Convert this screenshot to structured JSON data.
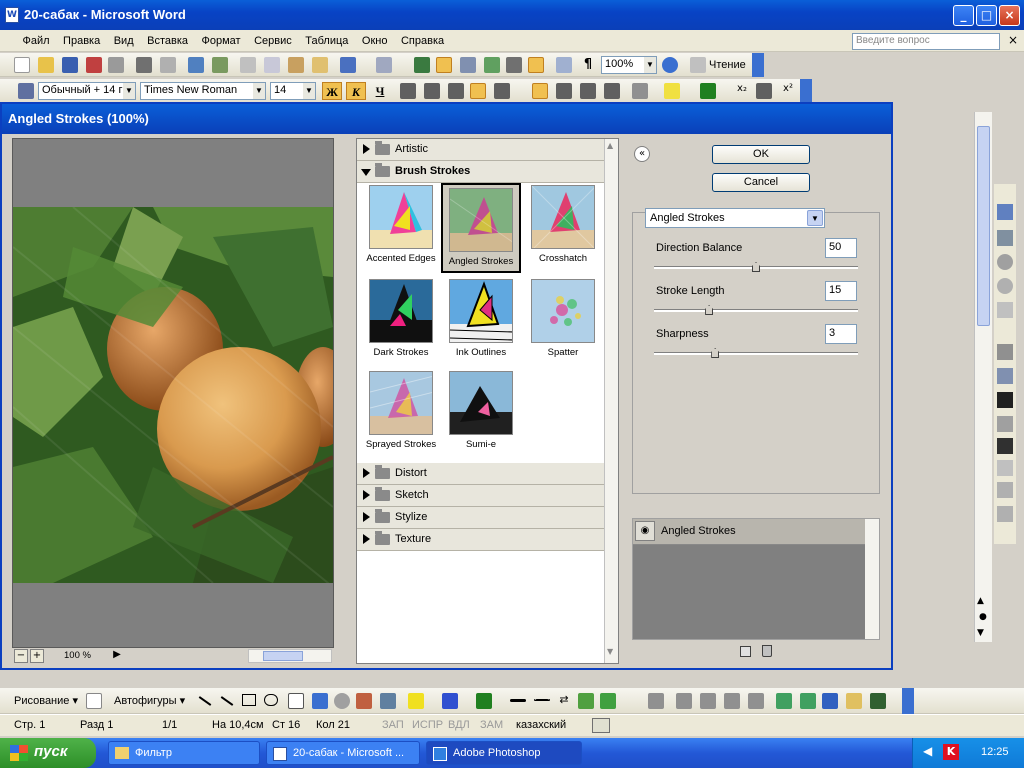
{
  "word": {
    "title": "20-сабак - Microsoft Word",
    "app_icon_glyph": "W",
    "menu": [
      "Файл",
      "Правка",
      "Вид",
      "Вставка",
      "Формат",
      "Сервис",
      "Таблица",
      "Окно",
      "Справка"
    ],
    "help_placeholder": "Введите вопрос",
    "zoom": "100%",
    "reading_label": "Чтение",
    "style": "Обычный + 14 г",
    "font": "Times New Roman",
    "font_size": "14",
    "bold": "Ж",
    "italic": "К",
    "underline": "Ч",
    "draw_label": "Рисование ▾",
    "autoshapes_label": "Автофигуры ▾",
    "status": {
      "page": "Стр. 1",
      "section": "Разд 1",
      "page_of": "1/1",
      "position": "На 10,4см",
      "line": "Ст 16",
      "col": "Кол 21",
      "rec": "ЗАП",
      "trk": "ИСПР",
      "ext": "ВДЛ",
      "ovr": "ЗАМ",
      "language": "казахский"
    }
  },
  "dialog": {
    "title": "Angled Strokes (100%)",
    "zoom_label": "100 %",
    "zoom_minus": "−",
    "zoom_plus": "+",
    "ok_label": "OK",
    "cancel_label": "Cancel",
    "collapse_glyph": "«",
    "filter_select": "Angled Strokes",
    "categories_top": [
      {
        "label": "Artistic",
        "open": false
      },
      {
        "label": "Brush Strokes",
        "open": true
      }
    ],
    "thumbnails": [
      {
        "label": "Accented Edges",
        "selected": false
      },
      {
        "label": "Angled Strokes",
        "selected": true
      },
      {
        "label": "Crosshatch",
        "selected": false
      },
      {
        "label": "Dark Strokes",
        "selected": false
      },
      {
        "label": "Ink Outlines",
        "selected": false
      },
      {
        "label": "Spatter",
        "selected": false
      },
      {
        "label": "Sprayed Strokes",
        "selected": false
      },
      {
        "label": "Sumi-e",
        "selected": false
      }
    ],
    "categories_bottom": [
      "Distort",
      "Sketch",
      "Stylize",
      "Texture"
    ],
    "params": [
      {
        "label": "Direction Balance",
        "value": "50",
        "fraction": 0.5
      },
      {
        "label": "Stroke Length",
        "value": "15",
        "fraction": 0.27
      },
      {
        "label": "Sharpness",
        "value": "3",
        "fraction": 0.3
      }
    ],
    "layer_name": "Angled Strokes"
  },
  "taskbar": {
    "start": "пуск",
    "tasks": [
      {
        "label": "Фильтр",
        "active": false
      },
      {
        "label": "20-сабак - Microsoft ...",
        "active": false
      },
      {
        "label": "Adobe Photoshop",
        "active": true
      }
    ],
    "lang": "KK",
    "clock": "12:25"
  },
  "colors": {
    "title_blue": "#0a3fb8",
    "start_green": "#2d8f28",
    "apricot": "#d99a4e",
    "leaf_green": "#3f6a28"
  }
}
